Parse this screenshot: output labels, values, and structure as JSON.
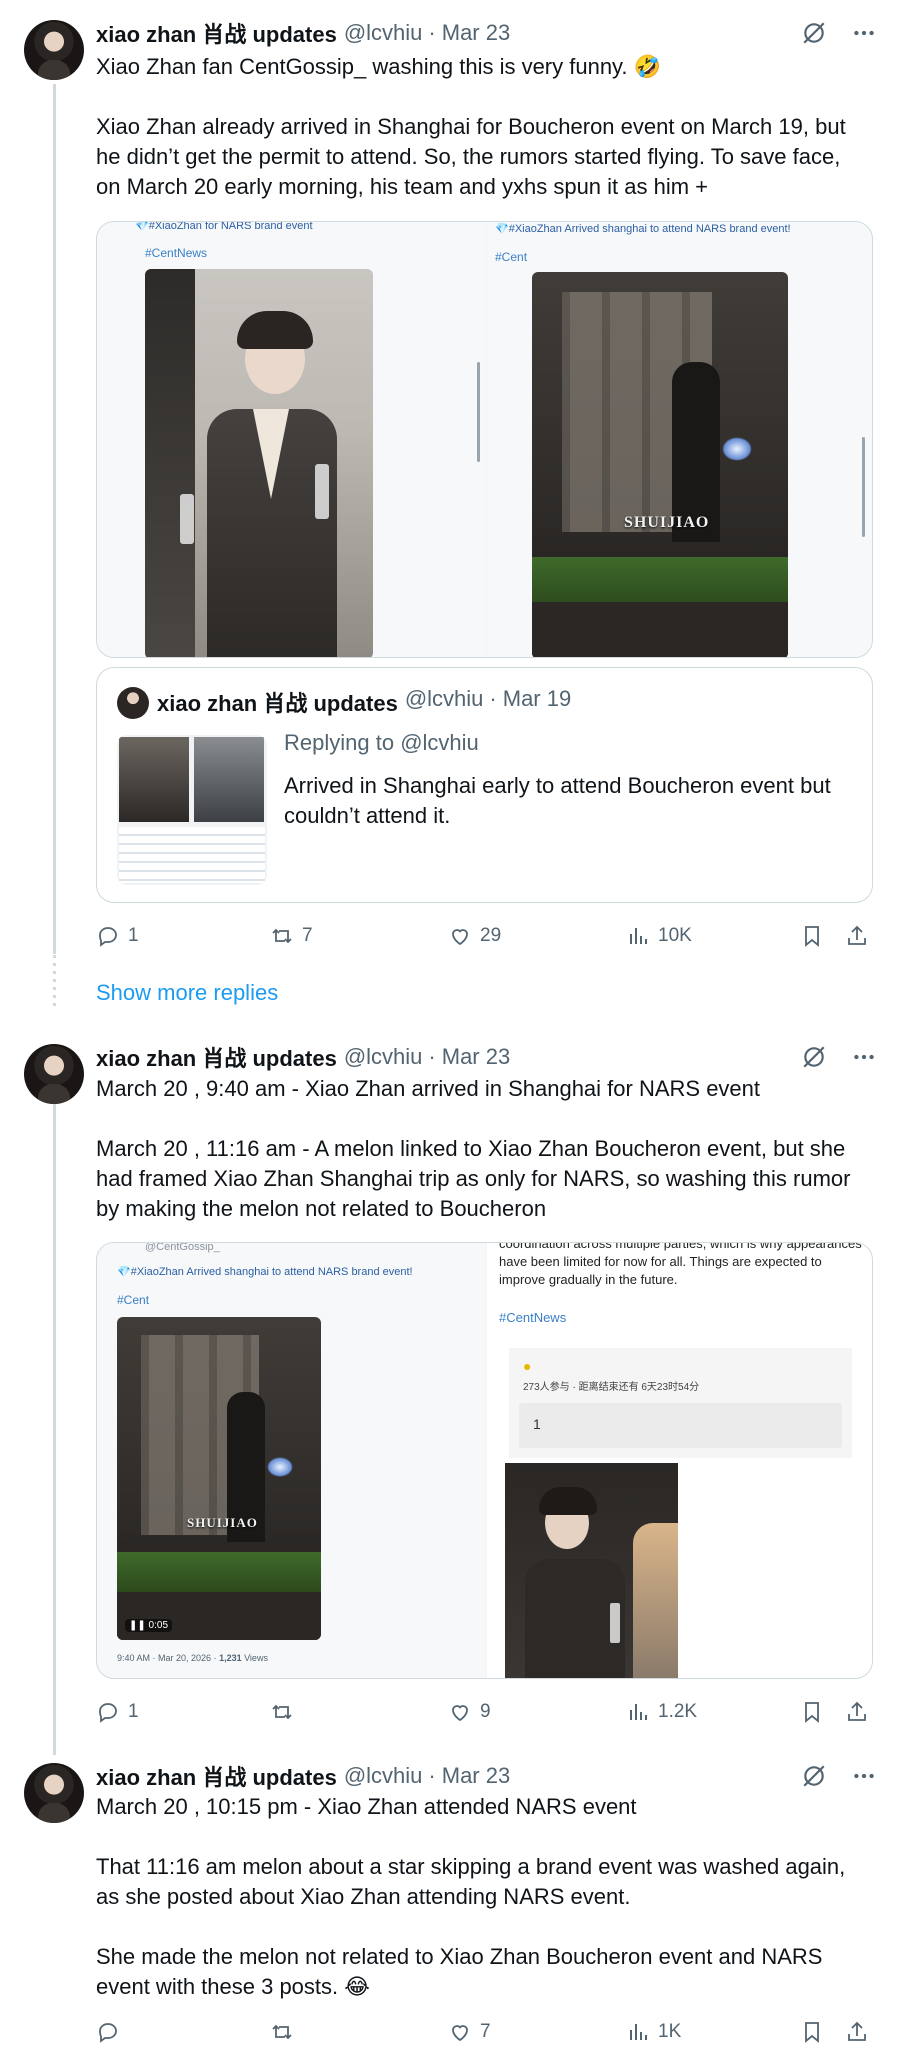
{
  "posts": [
    {
      "author": "xiao zhan 肖战 updates",
      "handle": "@lcvhiu",
      "date": "Mar 23",
      "paragraphs": [
        "Xiao Zhan fan CentGossip_ washing this is very funny. 🤣",
        "Xiao Zhan already arrived in Shanghai for Boucheron event on March 19, but he didn’t get the permit to attend. So, the rumors started flying. To save face, on March 20 early morning, his team and yxhs spun it as him +"
      ],
      "media": {
        "left_caption": "💎#XiaoZhan for NARS brand event",
        "left_tag": "#CentNews",
        "right_caption": "💎#XiaoZhan Arrived shanghai to attend NARS brand event!",
        "right_tag": "#Cent",
        "watermark": "SHUIJIAO"
      },
      "quote": {
        "author": "xiao zhan 肖战 updates",
        "handle": "@lcvhiu",
        "date": "Mar 19",
        "replying_prefix": "Replying to",
        "replying_to": "@lcvhiu",
        "text": "Arrived in Shanghai early to attend Boucheron event but couldn’t attend it."
      },
      "stats": {
        "replies": "1",
        "reposts": "7",
        "likes": "29",
        "views": "10K"
      }
    },
    {
      "author": "xiao zhan 肖战 updates",
      "handle": "@lcvhiu",
      "date": "Mar 23",
      "paragraphs": [
        "March 20 , 9:40 am - Xiao Zhan arrived in Shanghai for NARS event",
        "March 20 , 11:16 am - A melon linked to Xiao Zhan Boucheron event, but she had framed Xiao Zhan Shanghai trip as only for NARS, so washing this rumor by making the melon not related to Boucheron"
      ],
      "media": {
        "left_top": "@CentGossip_",
        "left_caption": "💎#XiaoZhan Arrived shanghai to attend NARS brand event!",
        "left_tag": "#Cent",
        "watermark": "SHUIJIAO",
        "video_time": "0:05",
        "left_footer_prefix": "9:40 AM · Mar 20, 2026 · ",
        "left_footer_views": "1,231",
        "left_footer_suffix": " Views",
        "right_text": "coordination across multiple parties, which is why appearances have been limited for now for all. Things are expected to improve gradually in the future.",
        "right_tag": "#CentNews",
        "poll_meta": "273人参与 · 距离结束还有 6天23时54分",
        "poll_option": "1"
      },
      "stats": {
        "replies": "1",
        "reposts": "",
        "likes": "9",
        "views": "1.2K"
      }
    },
    {
      "author": "xiao zhan 肖战 updates",
      "handle": "@lcvhiu",
      "date": "Mar 23",
      "paragraphs": [
        "March 20 , 10:15 pm - Xiao Zhan attended NARS event",
        "That 11:16 am melon about a star skipping a brand event was washed again, as she posted about Xiao Zhan attending NARS event.",
        "She made the melon not related to Xiao Zhan Boucheron event and NARS event with these 3 posts. 😂"
      ],
      "stats": {
        "replies": "",
        "reposts": "",
        "likes": "7",
        "views": "1K"
      }
    }
  ],
  "show_more_replies": "Show more replies",
  "colors": {
    "link": "#1d9bf0",
    "muted": "#536471",
    "border": "#cfd9de",
    "text": "#0f1419"
  }
}
